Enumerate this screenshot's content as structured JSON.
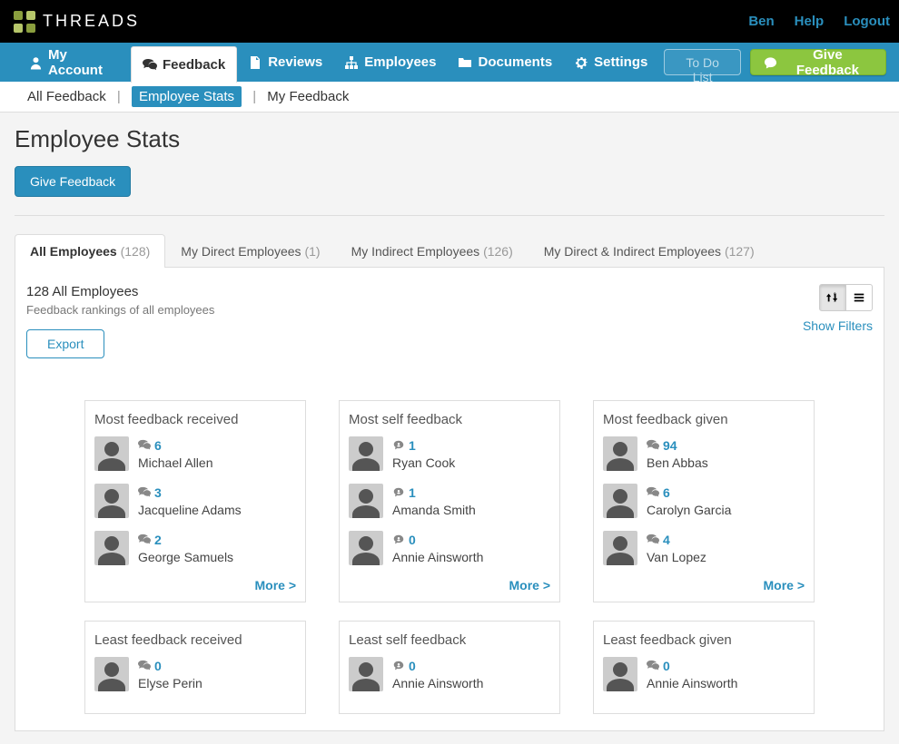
{
  "topbar": {
    "brand": "THREADS",
    "user_link": "Ben",
    "help_link": "Help",
    "logout_link": "Logout"
  },
  "nav": {
    "my_account": "My Account",
    "feedback": "Feedback",
    "reviews": "Reviews",
    "employees": "Employees",
    "documents": "Documents",
    "settings": "Settings",
    "todo": "To Do List",
    "give_feedback": "Give Feedback"
  },
  "subnav": {
    "all_feedback": "All Feedback",
    "employee_stats": "Employee Stats",
    "my_feedback": "My Feedback"
  },
  "page": {
    "title": "Employee Stats",
    "give_feedback_btn": "Give Feedback"
  },
  "tabs": {
    "all": {
      "label": "All Employees",
      "count": "(128)"
    },
    "direct": {
      "label": "My Direct Employees",
      "count": "(1)"
    },
    "indirect": {
      "label": "My Indirect Employees",
      "count": "(126)"
    },
    "both": {
      "label": "My Direct & Indirect Employees",
      "count": "(127)"
    }
  },
  "panel": {
    "title": "128 All Employees",
    "subtitle": "Feedback rankings of all employees",
    "show_filters": "Show Filters",
    "export": "Export",
    "more": "More >"
  },
  "cards": {
    "most_received": {
      "title": "Most feedback received",
      "items": [
        {
          "count": "6",
          "name": "Michael Allen"
        },
        {
          "count": "3",
          "name": "Jacqueline Adams"
        },
        {
          "count": "2",
          "name": "George Samuels"
        }
      ]
    },
    "most_self": {
      "title": "Most self feedback",
      "items": [
        {
          "count": "1",
          "name": "Ryan Cook"
        },
        {
          "count": "1",
          "name": "Amanda Smith"
        },
        {
          "count": "0",
          "name": "Annie Ainsworth"
        }
      ]
    },
    "most_given": {
      "title": "Most feedback given",
      "items": [
        {
          "count": "94",
          "name": "Ben Abbas"
        },
        {
          "count": "6",
          "name": "Carolyn Garcia"
        },
        {
          "count": "4",
          "name": "Van Lopez"
        }
      ]
    },
    "least_received": {
      "title": "Least feedback received",
      "items": [
        {
          "count": "0",
          "name": "Elyse Perin"
        }
      ]
    },
    "least_self": {
      "title": "Least self feedback",
      "items": [
        {
          "count": "0",
          "name": "Annie Ainsworth"
        }
      ]
    },
    "least_given": {
      "title": "Least feedback given",
      "items": [
        {
          "count": "0",
          "name": "Annie Ainsworth"
        }
      ]
    }
  }
}
